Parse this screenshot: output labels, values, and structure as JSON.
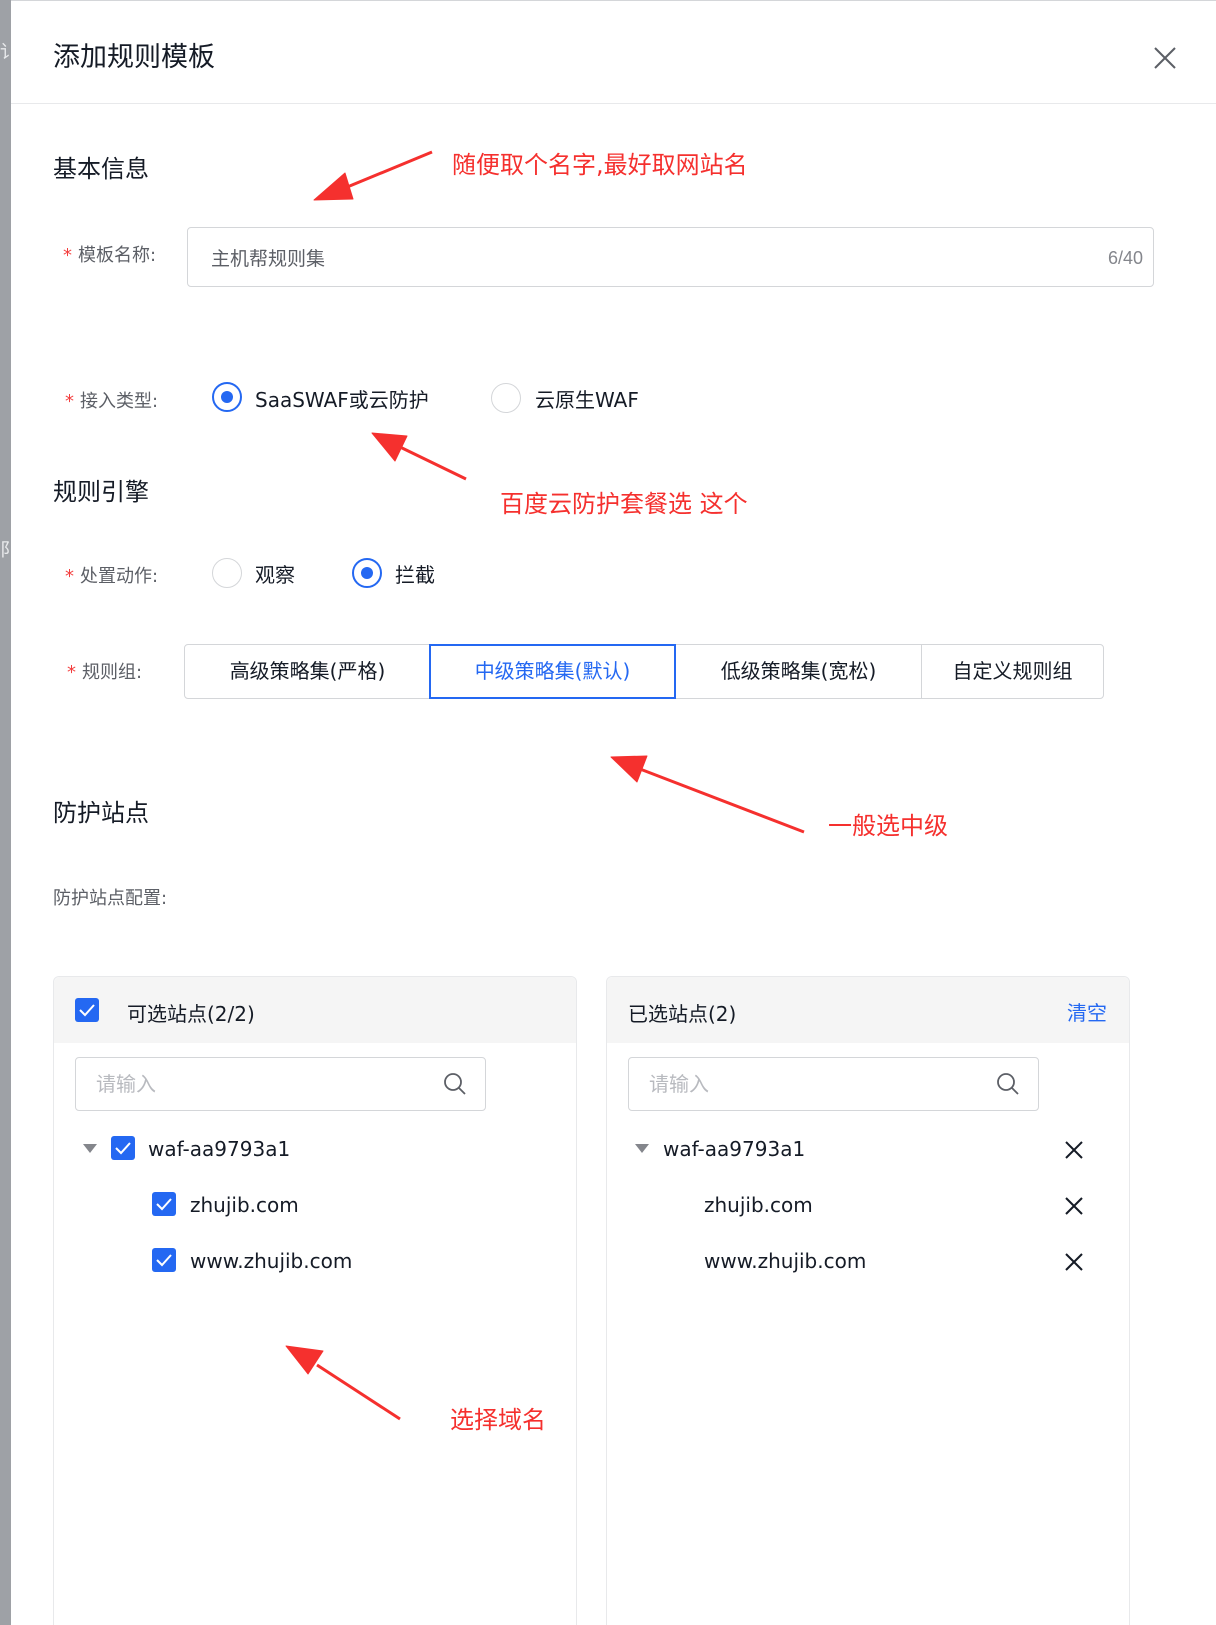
{
  "dialog": {
    "title": "添加规则模板"
  },
  "basic": {
    "section_title": "基本信息",
    "name_label": "模板名称:",
    "name_value": "主机帮规则集",
    "name_count": "6/40"
  },
  "access": {
    "label": "接入类型:",
    "options": [
      "SaaSWAF或云防护",
      "云原生WAF"
    ],
    "selected": "SaaSWAF或云防护"
  },
  "engine": {
    "section_title": "规则引擎",
    "action_label": "处置动作:",
    "action_options": [
      "观察",
      "拦截"
    ],
    "action_selected": "拦截",
    "group_label": "规则组:",
    "group_options": [
      "高级策略集(严格)",
      "中级策略集(默认)",
      "低级策略集(宽松)",
      "自定义规则组"
    ],
    "group_selected": "中级策略集(默认)"
  },
  "sites": {
    "section_title": "防护站点",
    "config_label": "防护站点配置:",
    "available": {
      "title": "可选站点(2/2)",
      "search_placeholder": "请输入",
      "root": "waf-aa9793a1",
      "children": [
        "zhujib.com",
        "www.zhujib.com"
      ]
    },
    "selected": {
      "title": "已选站点(2)",
      "clear_label": "清空",
      "search_placeholder": "请输入",
      "root": "waf-aa9793a1",
      "children": [
        "zhujib.com",
        "www.zhujib.com"
      ]
    }
  },
  "annotations": {
    "name_tip": "随便取个名字,最好取网站名",
    "access_tip": "百度云防护套餐选 这个",
    "group_tip": "一般选中级",
    "site_tip": "选择域名"
  },
  "colors": {
    "primary": "#2468f2",
    "annotation": "#f5302e",
    "required": "#f33e3e"
  }
}
